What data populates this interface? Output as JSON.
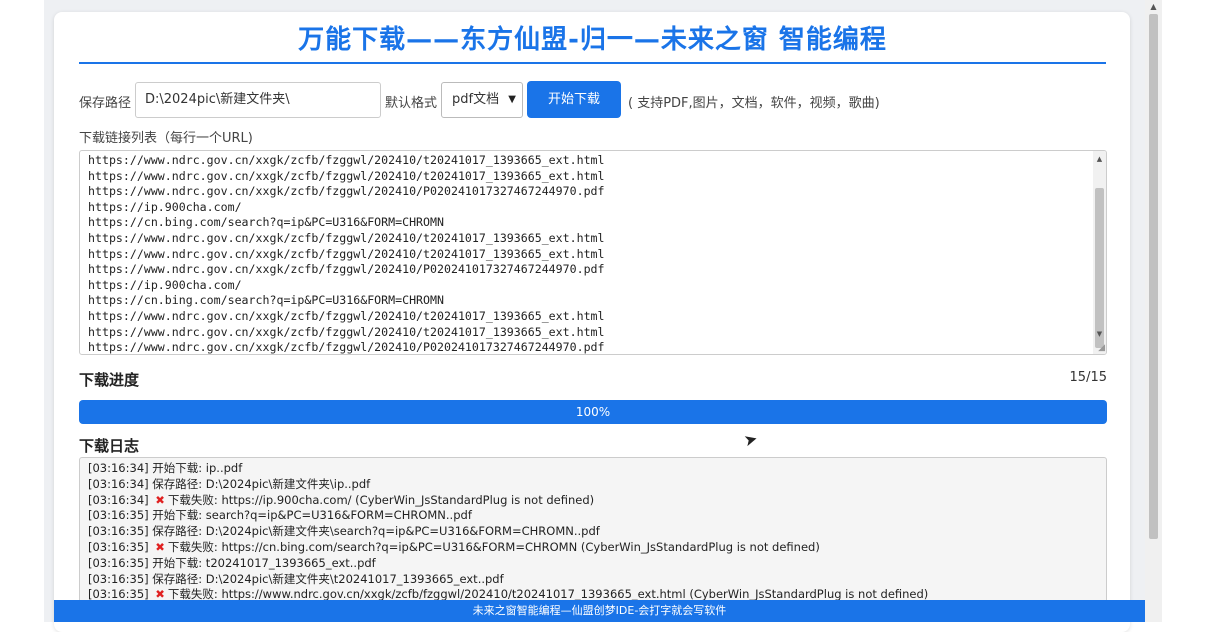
{
  "header": {
    "title": "万能下载——东方仙盟-归一—未来之窗 智能编程"
  },
  "controls": {
    "save_path_label": "保存路径",
    "save_path_value": "D:\\2024pic\\新建文件夹\\",
    "format_label": "默认格式",
    "format_value": "pdf文档",
    "start_button": "开始下载",
    "support_note": "( 支持PDF,图片，文档，软件，视频，歌曲)"
  },
  "url_list": {
    "label": "下载链接列表（每行一个URL)",
    "lines": [
      "https://www.ndrc.gov.cn/xxgk/zcfb/fzggwl/202410/t20241017_1393665_ext.html",
      "https://www.ndrc.gov.cn/xxgk/zcfb/fzggwl/202410/t20241017_1393665_ext.html",
      "https://www.ndrc.gov.cn/xxgk/zcfb/fzggwl/202410/P020241017327467244970.pdf",
      "https://ip.900cha.com/",
      "https://cn.bing.com/search?q=ip&PC=U316&FORM=CHROMN",
      "https://www.ndrc.gov.cn/xxgk/zcfb/fzggwl/202410/t20241017_1393665_ext.html",
      "https://www.ndrc.gov.cn/xxgk/zcfb/fzggwl/202410/t20241017_1393665_ext.html",
      "https://www.ndrc.gov.cn/xxgk/zcfb/fzggwl/202410/P020241017327467244970.pdf",
      "https://ip.900cha.com/",
      "https://cn.bing.com/search?q=ip&PC=U316&FORM=CHROMN",
      "https://www.ndrc.gov.cn/xxgk/zcfb/fzggwl/202410/t20241017_1393665_ext.html",
      "https://www.ndrc.gov.cn/xxgk/zcfb/fzggwl/202410/t20241017_1393665_ext.html",
      "https://www.ndrc.gov.cn/xxgk/zcfb/fzggwl/202410/P020241017327467244970.pdf"
    ]
  },
  "progress": {
    "heading": "下载进度",
    "count": "15/15",
    "percent_label": "100%",
    "fraction": 1.0
  },
  "log": {
    "heading": "下载日志",
    "lines": [
      "[03:16:34] 开始下载: ip..pdf",
      "[03:16:34] 保存路径: D:\\2024pic\\新建文件夹\\ip..pdf",
      "[03:16:34] ✖ 下载失败: https://ip.900cha.com/ (CyberWin_JsStandardPlug is not defined)",
      "[03:16:35] 开始下载: search?q=ip&PC=U316&FORM=CHROMN..pdf",
      "[03:16:35] 保存路径: D:\\2024pic\\新建文件夹\\search?q=ip&PC=U316&FORM=CHROMN..pdf",
      "[03:16:35] ✖ 下载失败: https://cn.bing.com/search?q=ip&PC=U316&FORM=CHROMN (CyberWin_JsStandardPlug is not defined)",
      "[03:16:35] 开始下载: t20241017_1393665_ext..pdf",
      "[03:16:35] 保存路径: D:\\2024pic\\新建文件夹\\t20241017_1393665_ext..pdf",
      "[03:16:35] ✖ 下载失败: https://www.ndrc.gov.cn/xxgk/zcfb/fzggwl/202410/t20241017_1393665_ext.html (CyberWin_JsStandardPlug is not defined)"
    ]
  },
  "footer": {
    "text": "未来之窗智能编程—仙盟创梦IDE-会打字就会写软件"
  },
  "colors": {
    "accent": "#1a74e8",
    "error": "#e02020"
  }
}
